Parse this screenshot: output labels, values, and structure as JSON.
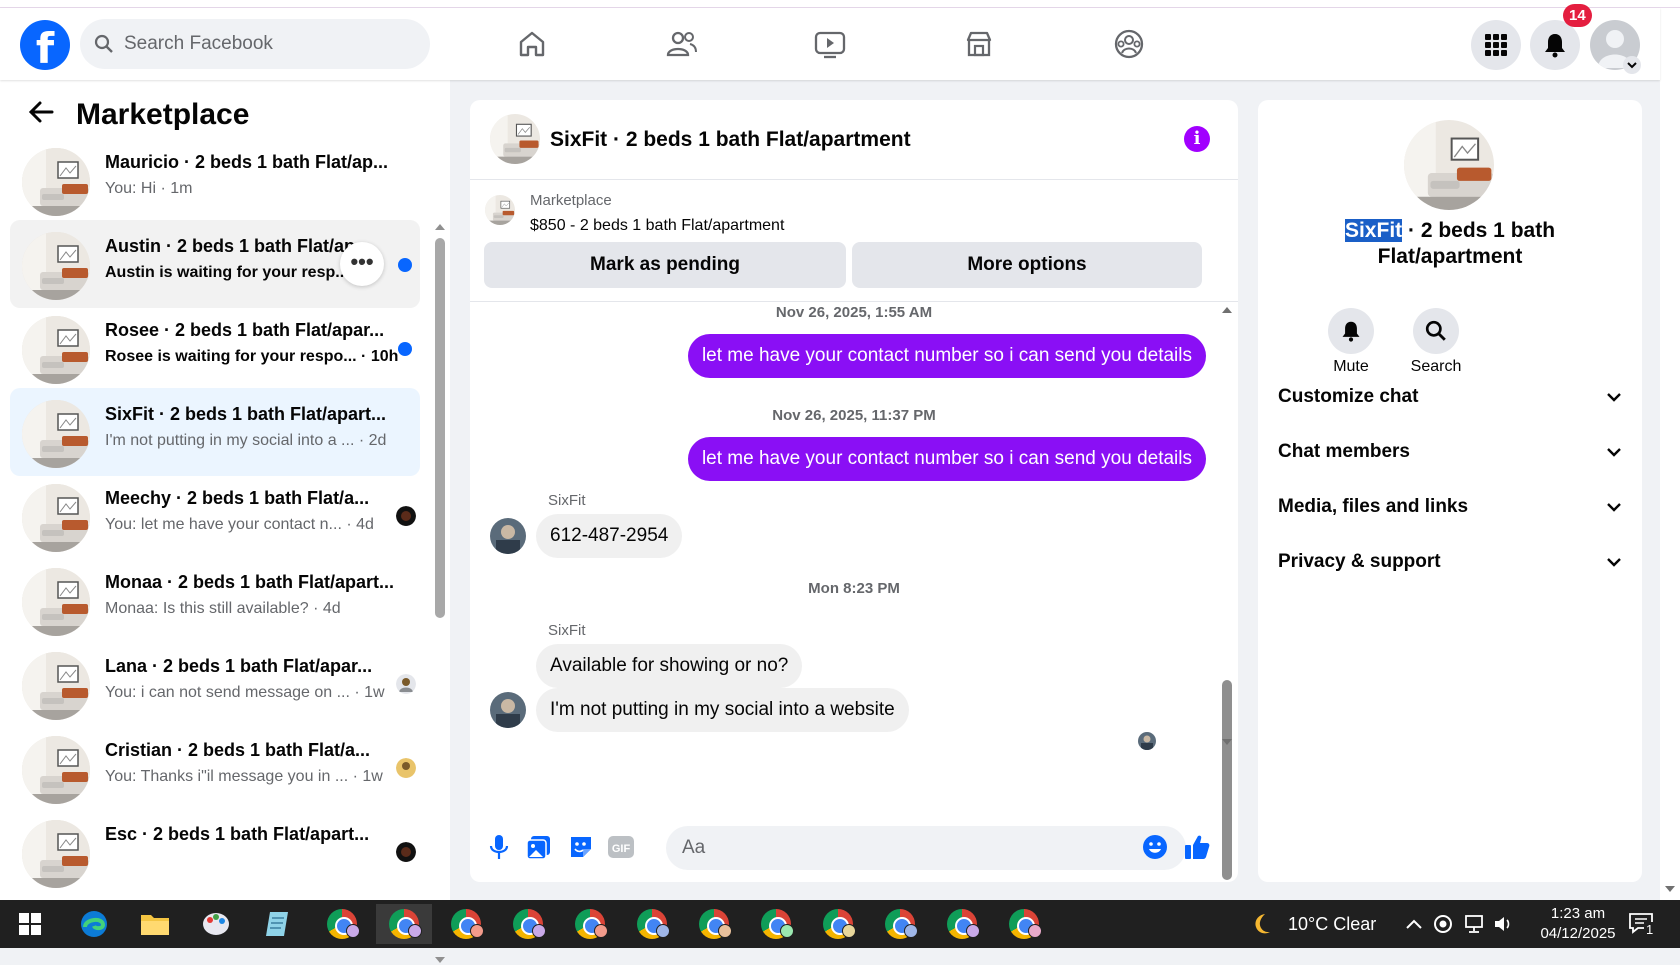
{
  "search": {
    "placeholder": "Search Facebook"
  },
  "nav": {
    "notifications_count": "14"
  },
  "left": {
    "title": "Marketplace",
    "conversations": [
      {
        "name": "Mauricio · 2 beds 1 bath Flat/ap...",
        "preview": "You: Hi · 1m",
        "unread": false
      },
      {
        "name": "Austin · 2 beds 1 bath Flat/ap",
        "preview": "Austin is waiting for your resp...",
        "unread": true
      },
      {
        "name": "Rosee · 2 beds 1 bath Flat/apar...",
        "preview": "Rosee is waiting for your respo... · 10h",
        "unread": true
      },
      {
        "name": "SixFit · 2 beds 1 bath Flat/apart...",
        "preview": "I'm not putting in my social into a ... · 2d",
        "unread": false
      },
      {
        "name": "Meechy · 2 beds 1 bath Flat/a...",
        "preview": "You: let me have your contact n... · 4d",
        "unread": false
      },
      {
        "name": "Monaa · 2 beds 1 bath Flat/apart...",
        "preview": "Monaa: Is this still available? · 4d",
        "unread": false
      },
      {
        "name": "Lana · 2 beds 1 bath Flat/apar...",
        "preview": "You: i can not send message on ... · 1w",
        "unread": false
      },
      {
        "name": "Cristian · 2 beds 1 bath Flat/a...",
        "preview": "You: Thanks i\"il message you in ... · 1w",
        "unread": false
      },
      {
        "name": "Esc · 2 beds 1 bath Flat/apart...",
        "preview": "",
        "unread": false
      }
    ]
  },
  "chat": {
    "title": "SixFit · 2 beds 1 bath Flat/apartment",
    "listing_source": "Marketplace",
    "listing_price": "$850 - 2 beds 1 bath Flat/apartment",
    "mark_pending": "Mark as pending",
    "more_options": "More options",
    "messages": [
      {
        "type": "timestamp",
        "text": "Nov 26, 2025, 1:55 AM"
      },
      {
        "type": "out",
        "text": "let me have your contact number so i can send you details"
      },
      {
        "type": "timestamp",
        "text": "Nov 26, 2025, 11:37 PM"
      },
      {
        "type": "out",
        "text": "let me have your contact number so i can send you details"
      },
      {
        "type": "sender",
        "text": "SixFit"
      },
      {
        "type": "in",
        "text": "612-487-2954"
      },
      {
        "type": "timestamp",
        "text": "Mon 8:23 PM"
      },
      {
        "type": "sender",
        "text": "SixFit"
      },
      {
        "type": "in",
        "text": "Available for showing or no?"
      },
      {
        "type": "in",
        "text": "I'm not putting in my social into a website"
      }
    ],
    "composer_placeholder": "Aa"
  },
  "details": {
    "title_highlight": "SixFit",
    "title_rest": " · 2 beds 1 bath Flat/apartment",
    "mute_label": "Mute",
    "search_label": "Search",
    "sections": [
      "Customize chat",
      "Chat members",
      "Media, files and links",
      "Privacy & support"
    ]
  },
  "taskbar": {
    "weather": "10°C  Clear",
    "time": "1:23 am",
    "date": "04/12/2025",
    "notif": "1"
  },
  "colors": {
    "brand": "#0866ff",
    "accent_purple": "#8a0ff5",
    "unread_dot": "#0866ff"
  }
}
